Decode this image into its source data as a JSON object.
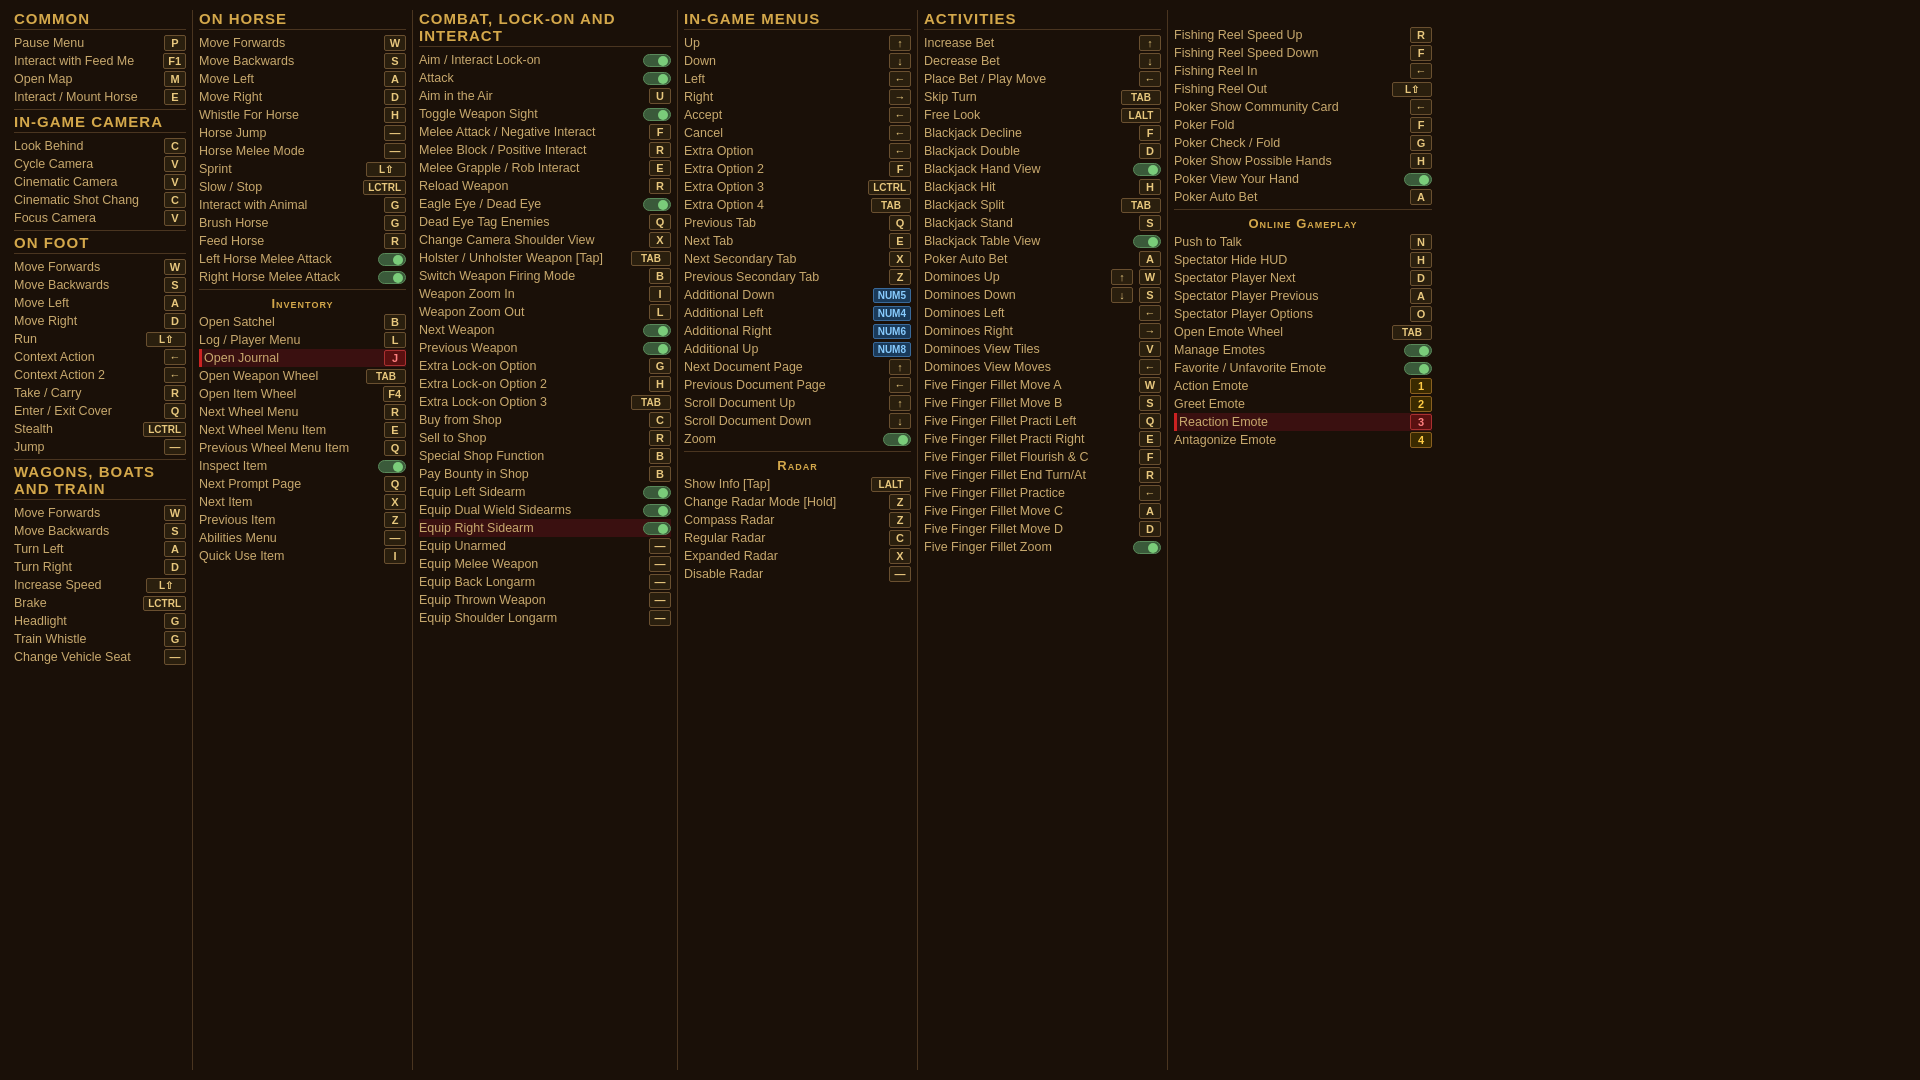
{
  "columns": [
    {
      "id": "col1",
      "sections": [
        {
          "header": "Common",
          "items": [
            {
              "label": "Pause Menu",
              "key": "P"
            },
            {
              "label": "Interact with Feed Me",
              "key": "F1"
            },
            {
              "label": "Open Map",
              "key": "M"
            },
            {
              "label": "Interact / Mount Horse",
              "key": "E"
            }
          ]
        },
        {
          "header": "In-Game Camera",
          "items": [
            {
              "label": "Look Behind",
              "key": "C"
            },
            {
              "label": "Cycle Camera",
              "key": "V"
            },
            {
              "label": "Cinematic Camera",
              "key": "V"
            },
            {
              "label": "Cinematic Shot Chang",
              "key": "C"
            },
            {
              "label": "Focus Camera",
              "key": "V"
            }
          ]
        },
        {
          "header": "On Foot",
          "items": [
            {
              "label": "Move Forwards",
              "key": "W"
            },
            {
              "label": "Move Backwards",
              "key": "S"
            },
            {
              "label": "Move Left",
              "key": "A"
            },
            {
              "label": "Move Right",
              "key": "D"
            },
            {
              "label": "Run",
              "key": "L⇧"
            },
            {
              "label": "Context Action",
              "key": "←"
            },
            {
              "label": "Context Action 2",
              "key": "←"
            },
            {
              "label": "Take / Carry",
              "key": "R"
            },
            {
              "label": "Enter / Exit Cover",
              "key": "Q"
            },
            {
              "label": "Stealth",
              "key": "LCTRL"
            },
            {
              "label": "Jump",
              "key": "—"
            }
          ]
        },
        {
          "header": "Wagons, Boats and Train",
          "items": [
            {
              "label": "Move Forwards",
              "key": "W"
            },
            {
              "label": "Move Backwards",
              "key": "S"
            },
            {
              "label": "Turn Left",
              "key": "A"
            },
            {
              "label": "Turn Right",
              "key": "D"
            },
            {
              "label": "Increase Speed",
              "key": "L⇧"
            },
            {
              "label": "Brake",
              "key": "LCTRL"
            },
            {
              "label": "Headlight",
              "key": "G"
            },
            {
              "label": "Train Whistle",
              "key": "G"
            },
            {
              "label": "Change Vehicle Seat",
              "key": "—"
            }
          ]
        }
      ]
    },
    {
      "id": "col2",
      "sections": [
        {
          "header": "On Horse",
          "items": [
            {
              "label": "Move Forwards",
              "key": "W"
            },
            {
              "label": "Move Backwards",
              "key": "S"
            },
            {
              "label": "Move Left",
              "key": "A"
            },
            {
              "label": "Move Right",
              "key": "D"
            },
            {
              "label": "Whistle For Horse",
              "key": "H"
            },
            {
              "label": "Horse Jump",
              "key": "—"
            },
            {
              "label": "Horse Melee Mode",
              "key": "—"
            },
            {
              "label": "Sprint",
              "key": "L⇧"
            },
            {
              "label": "Slow / Stop",
              "key": "LCTRL"
            },
            {
              "label": "Interact with Animal",
              "key": "G"
            },
            {
              "label": "Brush Horse",
              "key": "G"
            },
            {
              "label": "Feed Horse",
              "key": "R"
            },
            {
              "label": "Left Horse Melee Attack",
              "key": "⬤"
            },
            {
              "label": "Right Horse Melee Attack",
              "key": "⬤"
            }
          ]
        },
        {
          "header": "Inventory",
          "items": [
            {
              "label": "Open Satchel",
              "key": "B"
            },
            {
              "label": "Log / Player Menu",
              "key": "L"
            },
            {
              "label": "Open Journal",
              "key": "J"
            },
            {
              "label": "Open Weapon Wheel",
              "key": "TAB"
            },
            {
              "label": "Open Item Wheel",
              "key": "F4"
            },
            {
              "label": "Next Wheel Menu",
              "key": "R"
            },
            {
              "label": "Next Wheel Menu Item",
              "key": "E"
            },
            {
              "label": "Previous Wheel Menu Item",
              "key": "Q"
            },
            {
              "label": "Inspect Item",
              "key": "⬤"
            },
            {
              "label": "Next Prompt Page",
              "key": "Q"
            },
            {
              "label": "Next Item",
              "key": "X"
            },
            {
              "label": "Previous Item",
              "key": "Z"
            },
            {
              "label": "Abilities Menu",
              "key": "—"
            },
            {
              "label": "Quick Use Item",
              "key": "I"
            }
          ]
        }
      ]
    },
    {
      "id": "col3",
      "sections": [
        {
          "header": "Combat, Lock-On and Interact",
          "items": [
            {
              "label": "Aim / Interact Lock-on",
              "key": "⬤"
            },
            {
              "label": "Attack",
              "key": "⬤"
            },
            {
              "label": "Aim in the Air",
              "key": "U"
            },
            {
              "label": "Toggle Weapon Sight",
              "key": "⬤"
            },
            {
              "label": "Melee Attack / Negative Interact",
              "key": "F"
            },
            {
              "label": "Melee Block / Positive Interact",
              "key": "R"
            },
            {
              "label": "Melee Grapple / Rob Interact",
              "key": "E"
            },
            {
              "label": "Reload Weapon",
              "key": "R"
            },
            {
              "label": "Eagle Eye / Dead Eye",
              "key": "⬤"
            },
            {
              "label": "Dead Eye Tag Enemies",
              "key": "Q"
            },
            {
              "label": "Change Camera Shoulder View",
              "key": "X"
            },
            {
              "label": "Holster / Unholster Weapon [Tap]",
              "key": "TAB"
            },
            {
              "label": "Switch Weapon Firing Mode",
              "key": "B"
            },
            {
              "label": "Weapon Zoom In",
              "key": "I"
            },
            {
              "label": "Weapon Zoom Out",
              "key": "L"
            },
            {
              "label": "Next Weapon",
              "key": "⬤"
            },
            {
              "label": "Previous Weapon",
              "key": "⬤"
            },
            {
              "label": "Extra Lock-on Option",
              "key": "G"
            },
            {
              "label": "Extra Lock-on Option 2",
              "key": "H"
            },
            {
              "label": "Extra Lock-on Option 3",
              "key": "TAB"
            },
            {
              "label": "Buy from Shop",
              "key": "C"
            },
            {
              "label": "Sell to Shop",
              "key": "R"
            },
            {
              "label": "Special Shop Function",
              "key": "B"
            },
            {
              "label": "Pay Bounty in Shop",
              "key": "B"
            },
            {
              "label": "Equip Left Sidearm",
              "key": "⬤"
            },
            {
              "label": "Equip Dual Wield Sidearms",
              "key": "⬤"
            },
            {
              "label": "Equip Right Sidearm",
              "key": "⬤"
            },
            {
              "label": "Equip Unarmed",
              "key": "—"
            },
            {
              "label": "Equip Melee Weapon",
              "key": "—"
            },
            {
              "label": "Equip Back Longarm",
              "key": "—"
            },
            {
              "label": "Equip Thrown Weapon",
              "key": "—"
            },
            {
              "label": "Equip Shoulder Longarm",
              "key": "—"
            }
          ]
        }
      ]
    },
    {
      "id": "col4",
      "sections": [
        {
          "header": "In-Game Menus",
          "items": [
            {
              "label": "Up",
              "key": "↑"
            },
            {
              "label": "Down",
              "key": "↓"
            },
            {
              "label": "Left",
              "key": "←"
            },
            {
              "label": "Right",
              "key": "→"
            },
            {
              "label": "Accept",
              "key": "←"
            },
            {
              "label": "Cancel",
              "key": "←"
            },
            {
              "label": "Extra Option",
              "key": "←"
            },
            {
              "label": "Extra Option 2",
              "key": "F"
            },
            {
              "label": "Extra Option 3",
              "key": "LCTRL"
            },
            {
              "label": "Extra Option 4",
              "key": "TAB"
            },
            {
              "label": "Previous Tab",
              "key": "Q"
            },
            {
              "label": "Next Tab",
              "key": "E"
            },
            {
              "label": "Next Secondary Tab",
              "key": "X"
            },
            {
              "label": "Previous Secondary Tab",
              "key": "Z"
            },
            {
              "label": "Additional Down",
              "key": "NUM5"
            },
            {
              "label": "Additional Left",
              "key": "NUM4"
            },
            {
              "label": "Additional Right",
              "key": "NUM6"
            },
            {
              "label": "Additional Up",
              "key": "NUM8"
            },
            {
              "label": "Next Document Page",
              "key": "↑"
            },
            {
              "label": "Previous Document Page",
              "key": "←"
            },
            {
              "label": "Scroll Document Up",
              "key": "↑"
            },
            {
              "label": "Scroll Document Down",
              "key": "↓"
            },
            {
              "label": "Zoom",
              "key": "⬤"
            }
          ]
        },
        {
          "header": "Radar",
          "items": [
            {
              "label": "Show Info [Tap]",
              "key": "LALT"
            },
            {
              "label": "Change Radar Mode [Hold]",
              "key": "Z"
            },
            {
              "label": "Compass Radar",
              "key": "Z"
            },
            {
              "label": "Regular Radar",
              "key": "C"
            },
            {
              "label": "Expanded Radar",
              "key": "X"
            },
            {
              "label": "Disable Radar",
              "key": "—"
            }
          ]
        }
      ]
    },
    {
      "id": "col5",
      "sections": [
        {
          "header": "Activities",
          "items": [
            {
              "label": "Increase Bet",
              "key": "↑"
            },
            {
              "label": "Decrease Bet",
              "key": "↓"
            },
            {
              "label": "Place Bet / Play Move",
              "key": "←"
            },
            {
              "label": "Skip Turn",
              "key": "TAB"
            },
            {
              "label": "Free Look",
              "key": "LALT"
            },
            {
              "label": "Blackjack Decline",
              "key": "F"
            },
            {
              "label": "Blackjack Double",
              "key": "D"
            },
            {
              "label": "Blackjack Hand View",
              "key": "⬤"
            },
            {
              "label": "Blackjack Hit",
              "key": "H"
            },
            {
              "label": "Blackjack Split",
              "key": "TAB"
            },
            {
              "label": "Blackjack Stand",
              "key": "S"
            },
            {
              "label": "Blackjack Table View",
              "key": "⬤"
            },
            {
              "label": "Poker Auto Bet",
              "key": "A"
            },
            {
              "label": "Dominoes Up",
              "key": "↑W"
            },
            {
              "label": "Dominoes Down",
              "key": "↓S"
            },
            {
              "label": "Dominoes Left",
              "key": "←"
            },
            {
              "label": "Dominoes Right",
              "key": "→"
            },
            {
              "label": "Dominoes View Tiles",
              "key": "V"
            },
            {
              "label": "Dominoes View Moves",
              "key": "←"
            },
            {
              "label": "Five Finger Fillet Move A",
              "key": "W"
            },
            {
              "label": "Five Finger Fillet Move B",
              "key": "S"
            },
            {
              "label": "Five Finger Fillet Practi Left",
              "key": "Q"
            },
            {
              "label": "Five Finger Fillet Practi Right",
              "key": "E"
            },
            {
              "label": "Five Finger Fillet Flourish & C",
              "key": "F"
            },
            {
              "label": "Five Finger Fillet End Turn/At",
              "key": "R"
            },
            {
              "label": "Five Finger Fillet Practice",
              "key": "←"
            },
            {
              "label": "Five Finger Fillet Move C",
              "key": "A"
            },
            {
              "label": "Five Finger Fillet Move D",
              "key": "D"
            },
            {
              "label": "Five Finger Fillet Zoom",
              "key": "⬤"
            }
          ]
        }
      ]
    },
    {
      "id": "col6",
      "sections": [
        {
          "header": "",
          "items": [
            {
              "label": "Fishing Reel Speed Up",
              "key": "R"
            },
            {
              "label": "Fishing Reel Speed Down",
              "key": "F"
            },
            {
              "label": "Fishing Reel In",
              "key": "←"
            },
            {
              "label": "Fishing Reel Out",
              "key": "L⇧"
            },
            {
              "label": "Poker Show Community Card",
              "key": "←"
            },
            {
              "label": "Poker Fold",
              "key": "F"
            },
            {
              "label": "Poker Check / Fold",
              "key": "G"
            },
            {
              "label": "Poker Show Possible Hands",
              "key": "H"
            },
            {
              "label": "Poker View Your Hand",
              "key": "⬤"
            },
            {
              "label": "Poker Auto Bet",
              "key": "A"
            }
          ]
        },
        {
          "header": "Online Gameplay",
          "items": [
            {
              "label": "Push to Talk",
              "key": "N"
            },
            {
              "label": "Spectator Hide HUD",
              "key": "H"
            },
            {
              "label": "Spectator Player Next",
              "key": "D"
            },
            {
              "label": "Spectator Player Previous",
              "key": "A"
            },
            {
              "label": "Spectator Player Options",
              "key": "O"
            },
            {
              "label": "Open Emote Wheel",
              "key": "TAB"
            },
            {
              "label": "Manage Emotes",
              "key": "⬤"
            },
            {
              "label": "Favorite / Unfavorite Emote",
              "key": "⬤"
            },
            {
              "label": "Action Emote",
              "key": "1"
            },
            {
              "label": "Greet Emote",
              "key": "2"
            },
            {
              "label": "Reaction Emote",
              "key": "3"
            },
            {
              "label": "Antagonize Emote",
              "key": "4"
            }
          ]
        }
      ]
    }
  ]
}
